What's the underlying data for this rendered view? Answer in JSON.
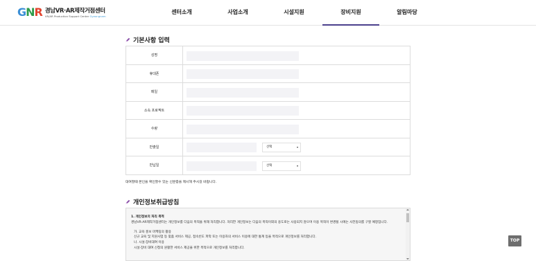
{
  "header": {
    "logo": {
      "mark": [
        "G",
        "N",
        "R"
      ],
      "mark_colors": [
        "#3b8fd6",
        "#2d9b4a",
        "#e2442f"
      ],
      "title": "경남VR·AR제작거점센터",
      "subtitle_prefix": "VR/AR Production Support Center",
      "subtitle_highlight": "Gyeongnam"
    },
    "nav": [
      {
        "label": "센터소개",
        "active": false
      },
      {
        "label": "사업소개",
        "active": false
      },
      {
        "label": "시설지원",
        "active": false
      },
      {
        "label": "장비지원",
        "active": true
      },
      {
        "label": "알림마당",
        "active": false
      }
    ],
    "accent_color": "#4a3f8c"
  },
  "form_section": {
    "title": "기본사항 입력",
    "icon": "pencil-icon",
    "rows": [
      {
        "label": "성명",
        "type": "text",
        "value": ""
      },
      {
        "label": "휴대폰",
        "type": "text",
        "value": ""
      },
      {
        "label": "메일",
        "type": "text",
        "value": ""
      },
      {
        "label": "소속 프로젝트",
        "type": "text",
        "value": ""
      },
      {
        "label": "수량",
        "type": "text",
        "value": ""
      },
      {
        "label": "반출일",
        "type": "date-select",
        "value": "",
        "select": "선택"
      },
      {
        "label": "반납일",
        "type": "date-select",
        "value": "",
        "select": "선택"
      }
    ],
    "note": "대여할때 본인을 확인할수 있는 신분증을 제시해 주시길 바랍니다."
  },
  "privacy_section": {
    "title": "개인정보취급방침",
    "icon": "pencil-icon",
    "heading": "1. 개인정보의 처리 목적",
    "intro": "경남VR·AR제작거점센터는 개인정보를 다음의 목적을 위해 처리합니다. 처리한 개인정보는 다음의 목적이외의 용도로는 사용되지 않으며 이용 목적이 변경될 시에는 사전동의를 구할 예정입니다.",
    "items": [
      "가. 교육 홍보 마케팅의 활용",
      "신규 교육 및 지원사업 등 맞춤 서비스 제공, 접속빈도 파악 또는 이용자의 서비스 이용에 대한 통계 등을 목적으로 개인정보를 처리합니다.",
      "나. 시설·장비대여 이용",
      "시설·장비 대여 신청의 원활한 서비스 제공을 위한 목적으로 개인정보를 처리합니다."
    ]
  },
  "top_button": "TOP"
}
